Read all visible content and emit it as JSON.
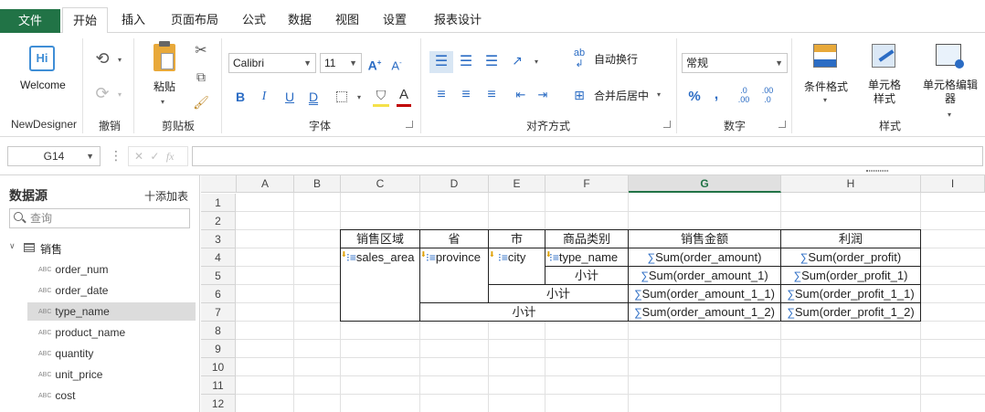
{
  "tabs": [
    "文件",
    "开始",
    "插入",
    "页面布局",
    "公式",
    "数据",
    "视图",
    "设置",
    "报表设计"
  ],
  "ribbon": {
    "welcome": {
      "label": "Welcome",
      "group": "NewDesigner"
    },
    "undo_group": "撤销",
    "clipboard": {
      "paste": "粘贴",
      "group": "剪贴板"
    },
    "font": {
      "family": "Calibri",
      "size": "11",
      "group": "字体"
    },
    "alignment": {
      "wrap": "自动换行",
      "merge": "合并后居中",
      "group": "对齐方式"
    },
    "number": {
      "format": "常规",
      "group": "数字"
    },
    "styles": {
      "conditional": "条件格式",
      "cell_style": "单元格样式",
      "cell_editor": "单元格编辑器",
      "group": "样式"
    }
  },
  "formula_bar": {
    "cell_ref": "G14",
    "fx": "fx"
  },
  "datasource": {
    "title": "数据源",
    "add": "十添加表",
    "search_placeholder": "查询",
    "table": "销售",
    "fields": [
      "order_num",
      "order_date",
      "type_name",
      "product_name",
      "quantity",
      "unit_price",
      "cost"
    ],
    "selected": "type_name"
  },
  "sheet": {
    "columns": [
      "A",
      "B",
      "C",
      "D",
      "E",
      "F",
      "G",
      "H",
      "I"
    ],
    "selected_column": "G",
    "rows": [
      "1",
      "2",
      "3",
      "4",
      "5",
      "6",
      "7",
      "8",
      "9",
      "10",
      "11",
      "12"
    ],
    "headers": {
      "sales_area": "销售区域",
      "province": "省",
      "city": "市",
      "type": "商品类别",
      "amount": "销售金额",
      "profit": "利润"
    },
    "fields": {
      "sales_area": "sales_area",
      "province": "province",
      "city": "city",
      "type": "type_name"
    },
    "subtotal": "小计",
    "sums": {
      "r4_amount": "Sum(order_amount)",
      "r4_profit": "Sum(order_profit)",
      "r5_amount": "Sum(order_amount_1)",
      "r5_profit": "Sum(order_profit_1)",
      "r6_amount": "Sum(order_amount_1_1)",
      "r6_profit": "Sum(order_profit_1_1)",
      "r7_amount": "Sum(order_amount_1_2)",
      "r7_profit": "Sum(order_profit_1_2)"
    }
  }
}
